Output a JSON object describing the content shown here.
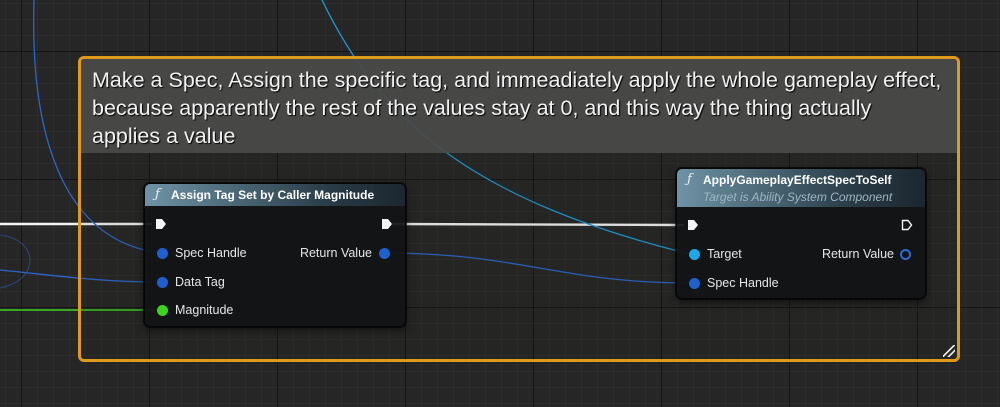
{
  "comment": {
    "text": "Make a Spec, Assign the specific tag, and immeadiately apply the whole gameplay effect, because apparently the rest of the values stay at 0, and this way the thing actually applies a value",
    "border_color": "#e09a1a"
  },
  "nodes": {
    "assign_tag": {
      "icon": "function-icon",
      "icon_glyph": "ƒ",
      "title": "Assign Tag Set by Caller Magnitude",
      "inputs": {
        "spec_handle": "Spec Handle",
        "data_tag": "Data Tag",
        "magnitude": "Magnitude"
      },
      "outputs": {
        "return_value": "Return Value"
      }
    },
    "apply_effect": {
      "icon": "function-icon",
      "icon_glyph": "ƒ",
      "title": "ApplyGameplayEffectSpecToSelf",
      "subtitle": "Target is Ability System Component",
      "inputs": {
        "target": "Target",
        "spec_handle": "Spec Handle"
      },
      "outputs": {
        "return_value": "Return Value"
      }
    }
  },
  "colors": {
    "exec_wire": "#f2f2f2",
    "struct_pin": "#1f5fd0",
    "object_pin": "#1ea7e6",
    "float_pin": "#3ed31e",
    "node_header": "#4b6776"
  }
}
